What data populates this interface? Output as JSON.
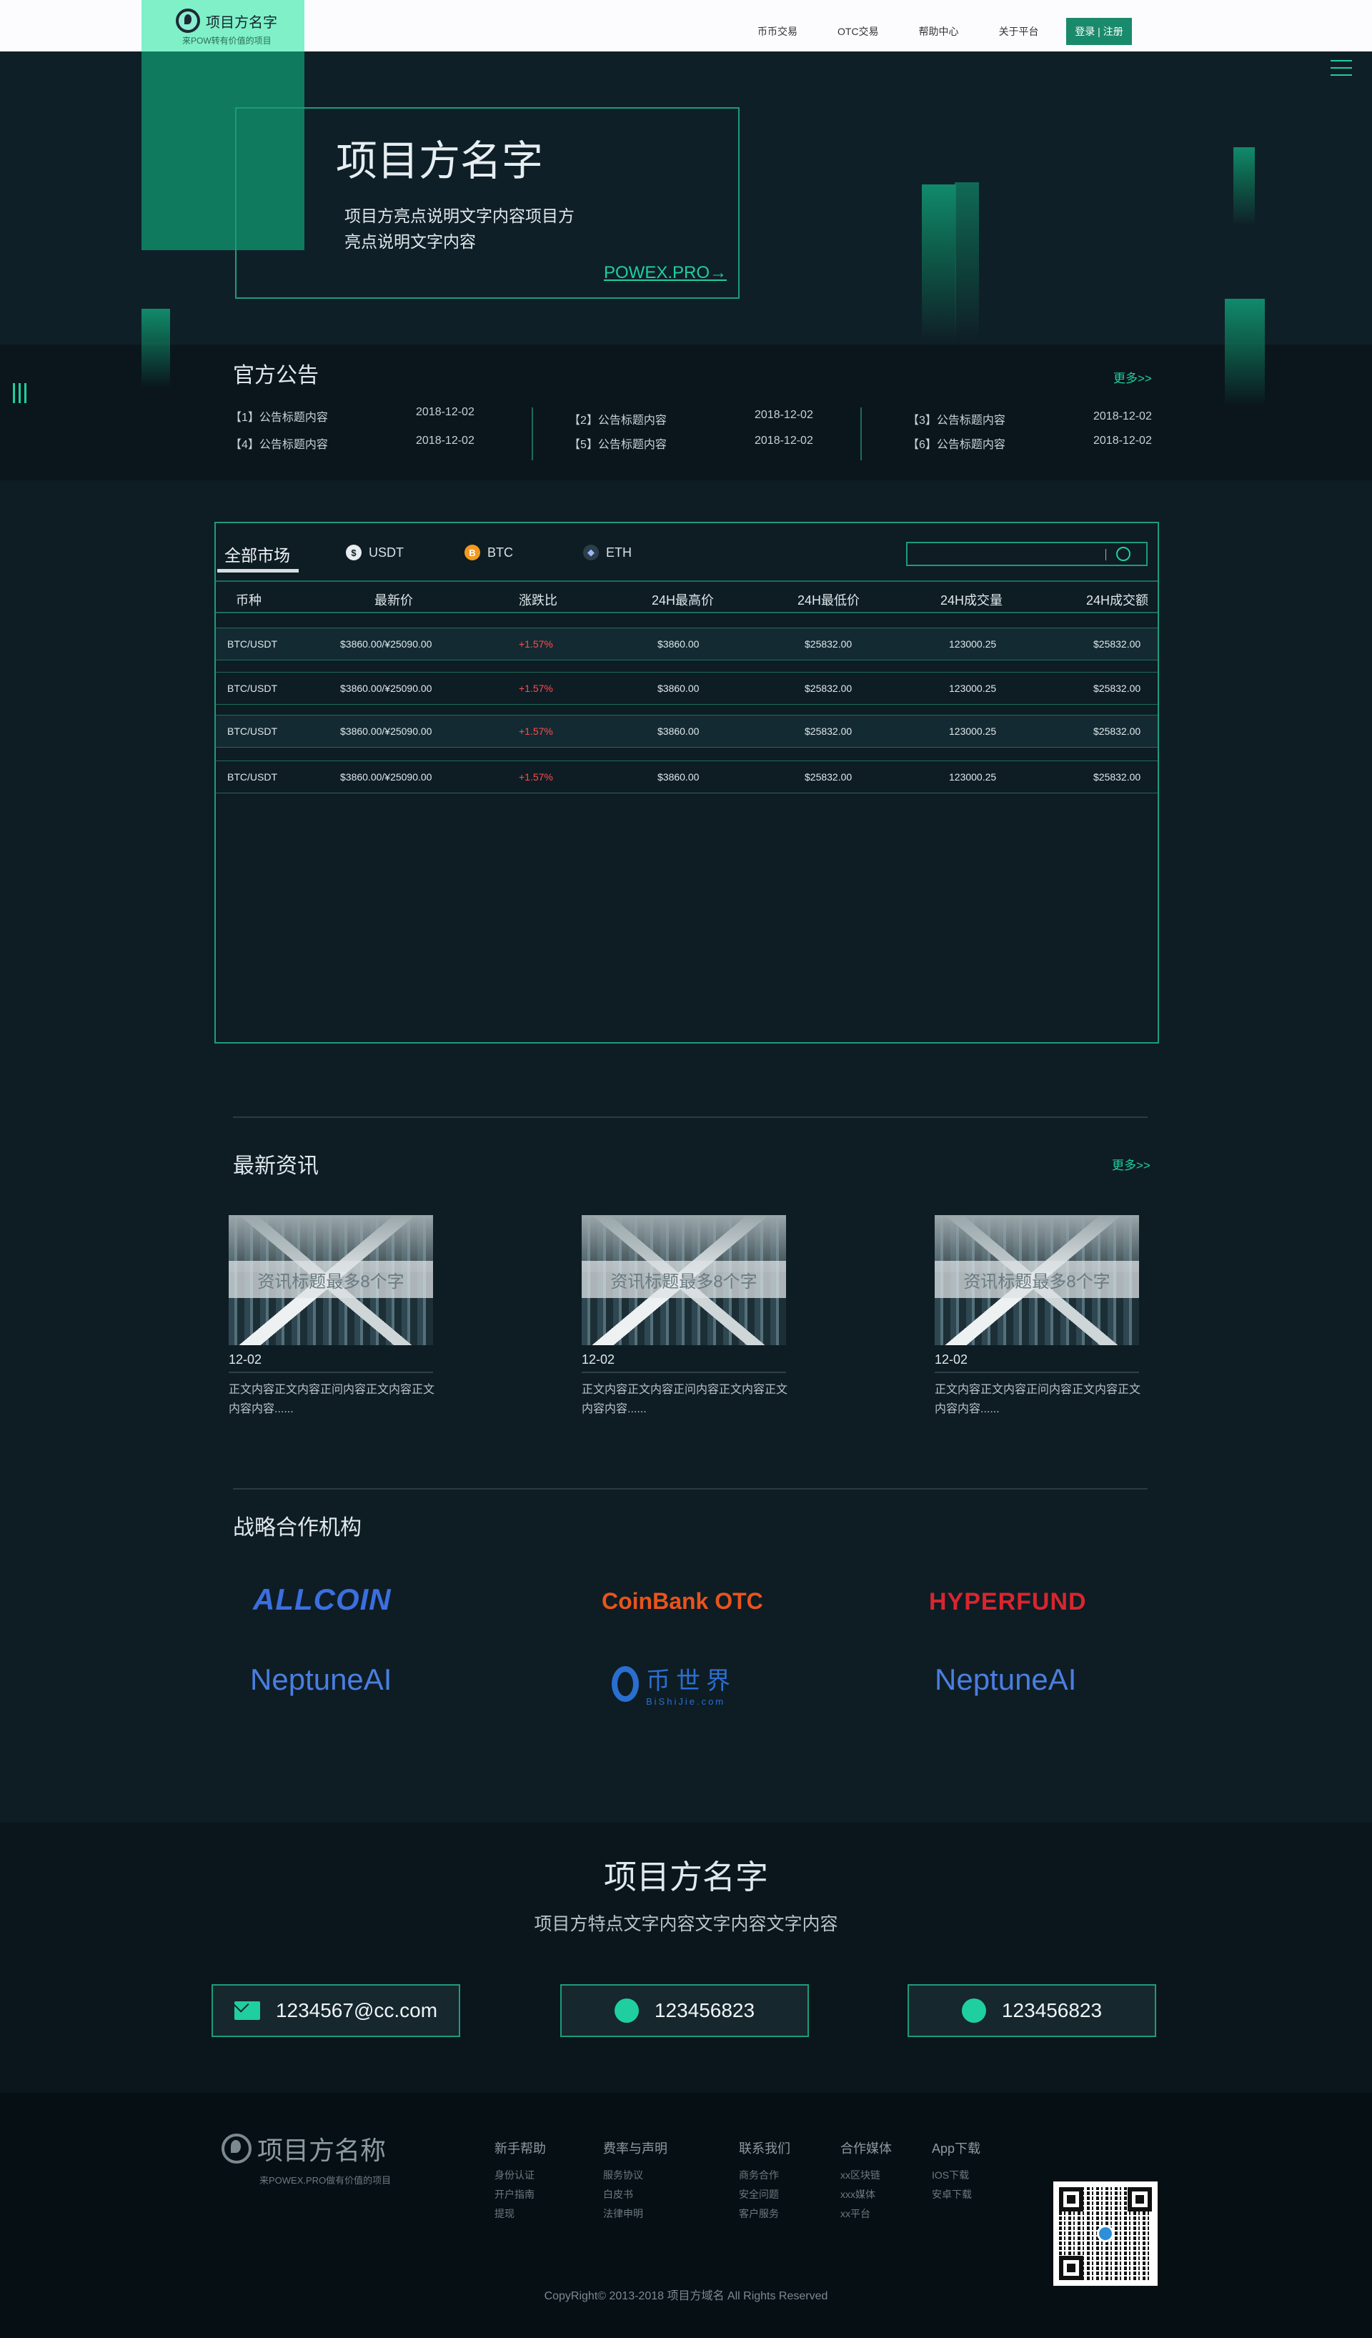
{
  "header": {
    "brand_title": "项目方名字",
    "brand_sub": "来POW转有价值的项目",
    "nav": [
      "币币交易",
      "OTC交易",
      "帮助中心",
      "关于平台"
    ],
    "login": "登录 | 注册"
  },
  "hero": {
    "title": "项目方名字",
    "desc": "项目方亮点说明文字内容项目方亮点说明文字内容",
    "link": "POWEX.PRO→"
  },
  "notice": {
    "title": "官方公告",
    "more": "更多>>",
    "items": [
      {
        "label": "【1】公告标题内容",
        "date": "2018-12-02"
      },
      {
        "label": "【4】公告标题内容",
        "date": "2018-12-02"
      },
      {
        "label": "【2】公告标题内容",
        "date": "2018-12-02"
      },
      {
        "label": "【5】公告标题内容",
        "date": "2018-12-02"
      },
      {
        "label": "【3】公告标题内容",
        "date": "2018-12-02"
      },
      {
        "label": "【6】公告标题内容",
        "date": "2018-12-02"
      }
    ]
  },
  "market": {
    "tabs": [
      "全部市场",
      "USDT",
      "BTC",
      "ETH"
    ],
    "search_placeholder": "",
    "headers": [
      "币种",
      "最新价",
      "涨跌比",
      "24H最高价",
      "24H最低价",
      "24H成交量",
      "24H成交额"
    ],
    "rows": [
      [
        "BTC/USDT",
        "$3860.00/¥25090.00",
        "+1.57%",
        "$3860.00",
        "$25832.00",
        "123000.25",
        "$25832.00"
      ],
      [
        "BTC/USDT",
        "$3860.00/¥25090.00",
        "+1.57%",
        "$3860.00",
        "$25832.00",
        "123000.25",
        "$25832.00"
      ],
      [
        "BTC/USDT",
        "$3860.00/¥25090.00",
        "+1.57%",
        "$3860.00",
        "$25832.00",
        "123000.25",
        "$25832.00"
      ],
      [
        "BTC/USDT",
        "$3860.00/¥25090.00",
        "+1.57%",
        "$3860.00",
        "$25832.00",
        "123000.25",
        "$25832.00"
      ]
    ]
  },
  "news": {
    "title": "最新资讯",
    "more": "更多>>",
    "cards": [
      {
        "caption": "资讯标题最多8个字",
        "date": "12-02",
        "text": "正文内容正文内容正问内容正文内容正文内容内容......"
      },
      {
        "caption": "资讯标题最多8个字",
        "date": "12-02",
        "text": "正文内容正文内容正问内容正文内容正文内容内容......"
      },
      {
        "caption": "资讯标题最多8个字",
        "date": "12-02",
        "text": "正文内容正文内容正问内容正文内容正文内容内容......"
      }
    ]
  },
  "partners": {
    "title": "战略合作机构",
    "names": [
      "ALLCOIN",
      "CoinBank OTC",
      "HYPERFUND",
      "NeptuneAI",
      "币世界",
      "NeptuneAI"
    ],
    "sub_bishijie": "BiShiJie.com",
    "colors": {
      "allcoin": "#3b6fe0",
      "coinbank": "#e8541c",
      "hyper": "#d8262f",
      "fund": "#3a3a3a",
      "neptune": "#4a7ee0",
      "bishijie": "#2a6fd0"
    }
  },
  "contact": {
    "title": "项目方名字",
    "sub": "项目方特点文字内容文字内容文字内容",
    "email": "1234567@cc.com",
    "wechat": "123456823",
    "qq": "123456823"
  },
  "footer": {
    "brand_title": "项目方名称",
    "brand_sub": "来POWEX.PRO做有价值的项目",
    "cols": [
      {
        "head": "新手帮助",
        "items": [
          "身份认证",
          "开户指南",
          "提现"
        ]
      },
      {
        "head": "费率与声明",
        "items": [
          "服务协议",
          "白皮书",
          "法律申明"
        ]
      },
      {
        "head": "联系我们",
        "items": [
          "商务合作",
          "安全问题",
          "客户服务"
        ]
      },
      {
        "head": "合作媒体",
        "items": [
          "xx区块链",
          "xxx媒体",
          "xx平台"
        ]
      },
      {
        "head": "App下载",
        "items": [
          "IOS下载",
          "安卓下载"
        ]
      }
    ],
    "copyright": "CopyRight© 2013-2018 项目方域名 All Rights Reserved"
  },
  "colors": {
    "accent": "#1fcfa0",
    "bg": "#0e1c24",
    "up": "#ff4d4d"
  }
}
